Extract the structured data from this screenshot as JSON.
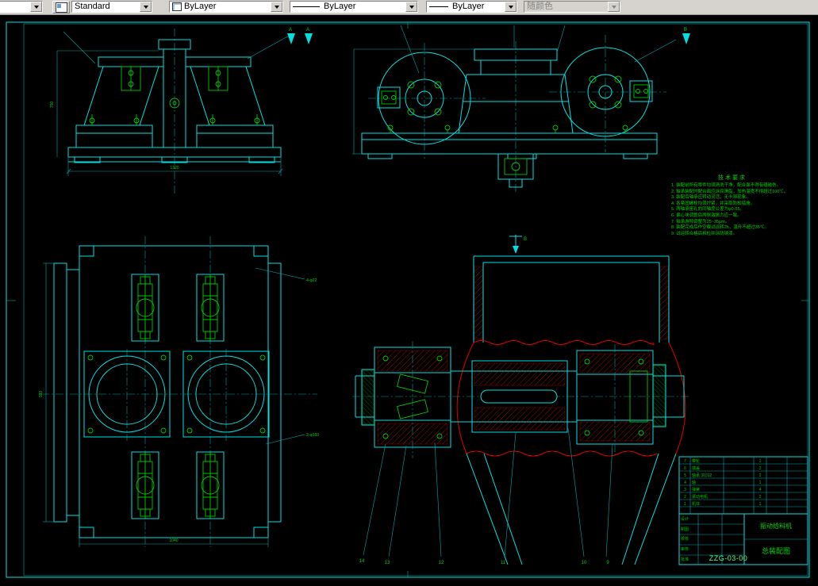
{
  "toolbar": {
    "style_combo": "Standard",
    "color_combo": "ByLayer",
    "linetype_combo": "ByLayer",
    "lineweight_combo": "ByLayer",
    "plotstyle_combo": "随颜色"
  },
  "labels": {
    "flag_a1": "A",
    "flag_a2": "A",
    "flag_b": "B",
    "section_arrow": "B"
  },
  "dims": {
    "front_width": "1320",
    "front_height": "750",
    "plan_width": "1040",
    "plan_height": "980",
    "callout1": "4-φ22",
    "callout2": "2-φ160"
  },
  "balloons": [
    "14",
    "13",
    "12",
    "11",
    "10",
    "9"
  ],
  "notes": {
    "title": "技术要求",
    "lines": [
      "1. 装配前所有零件均须清洗干净，配合面不得有磕碰伤。",
      "2. 轴承装配时配合面应涂润滑脂，加热温度不得超过100℃。",
      "3. 装配后轴承应转动灵活，无卡滞现象。",
      "4. 各紧固螺栓均须拧紧，并采取防松措施。",
      "5. 两轴承座孔的同轴度公差为φ0.05。",
      "6. 偏心块调整后两侧激振力应一致。",
      "7. 轴承游隙调整为25~35μm。",
      "8. 装配完成后作空载试运转2h，温升不超过35℃。",
      "9. 试运转合格后拆检并涂防锈漆。"
    ]
  },
  "title_block": {
    "drawing_no": "ZZG-03-00",
    "title_line1": "振动给料机",
    "title_line2": "总装配图",
    "rows_left": [
      "设计",
      "制图",
      "校核",
      "审核",
      "批准"
    ],
    "bom": [
      {
        "no": "7",
        "name": "带轮",
        "qty": "1"
      },
      {
        "no": "6",
        "name": "端盖",
        "qty": "2"
      },
      {
        "no": "5",
        "name": "轴承 30312",
        "qty": "2"
      },
      {
        "no": "4",
        "name": "轴",
        "qty": "1"
      },
      {
        "no": "3",
        "name": "弹簧",
        "qty": "4"
      },
      {
        "no": "2",
        "name": "振动电机",
        "qty": "2"
      },
      {
        "no": "1",
        "name": "机体",
        "qty": "1"
      }
    ]
  }
}
